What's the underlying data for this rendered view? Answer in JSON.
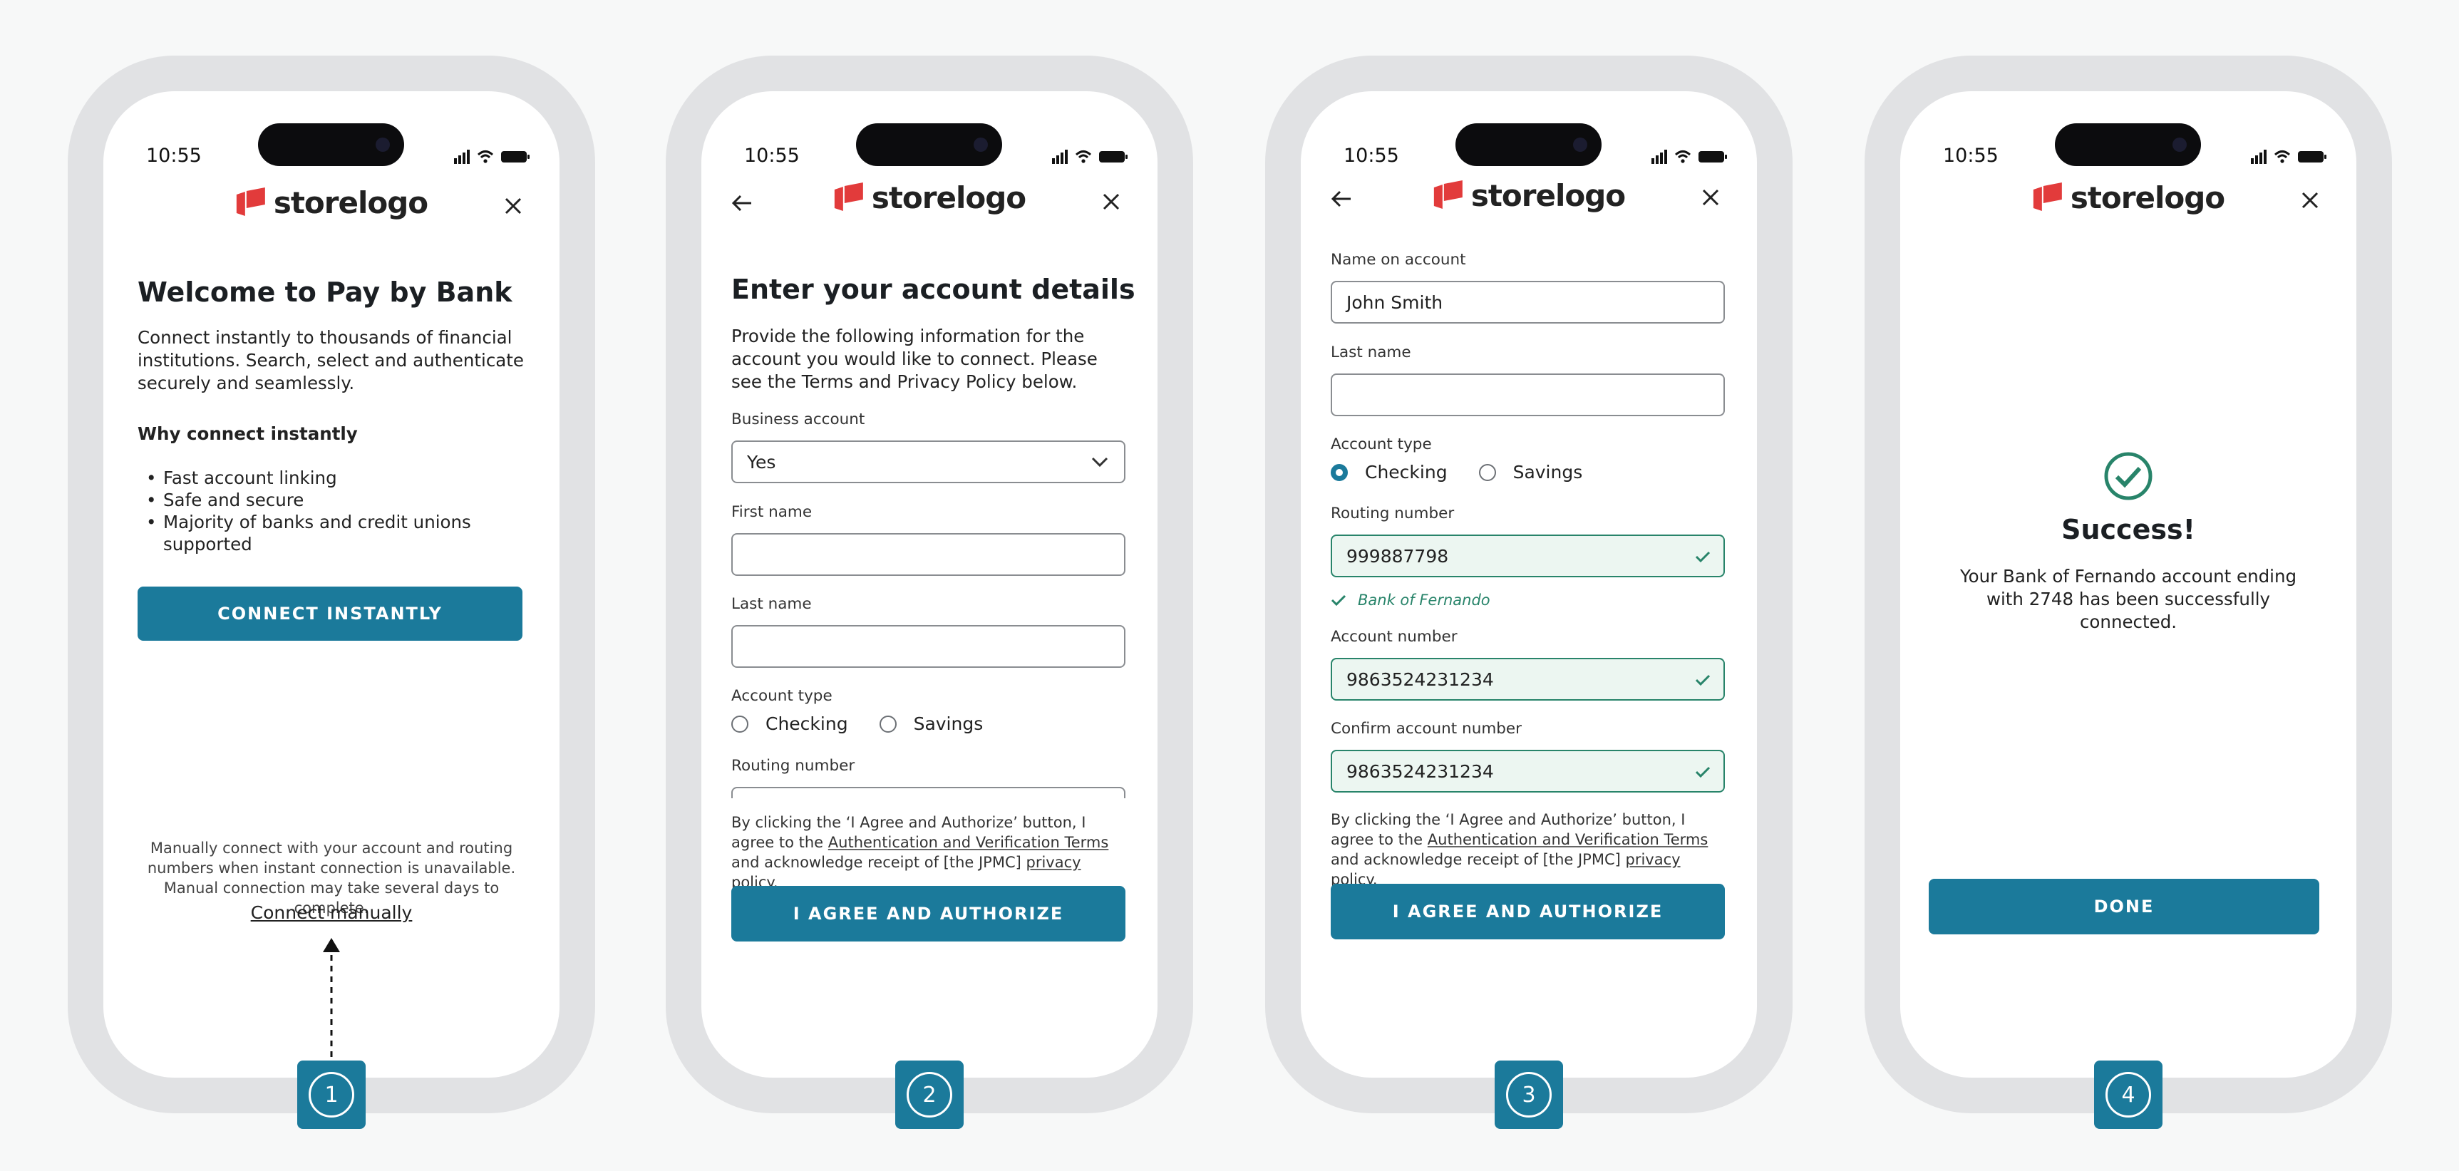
{
  "status": {
    "time": "10:55"
  },
  "brand": {
    "name": "storelogo",
    "color": "#e23b3b"
  },
  "accent": "#1b7a9b",
  "success_color": "#28846a",
  "screen1": {
    "title": "Welcome to Pay by Bank",
    "intro": "Connect instantly to thousands of financial institutions. Search, select and authenticate securely and seamlessly.",
    "why_heading": "Why connect instantly",
    "bullets": [
      "Fast account linking",
      "Safe and secure",
      "Majority of banks and credit unions supported"
    ],
    "cta": "CONNECT INSTANTLY",
    "manual_note": "Manually connect with your account and routing numbers when instant connection is unavailable. Manual connection may take several days to complete.",
    "manual_link": "Connect manually",
    "step": "1"
  },
  "screen2": {
    "title": "Enter your account details",
    "intro": "Provide the following information for the account you would like to connect. Please see the Terms and Privacy Policy below.",
    "business_label": "Business account",
    "business_value": "Yes",
    "first_name_label": "First name",
    "last_name_label": "Last name",
    "account_type_label": "Account type",
    "checking": "Checking",
    "savings": "Savings",
    "routing_label": "Routing number",
    "legal_1": "By clicking the ‘I Agree and Authorize’ button, I agree to the ",
    "legal_link": "Authentication and Verification Terms",
    "legal_2": " and acknowledge receipt of [the JPMC] ",
    "legal_link2": "privacy policy",
    "legal_3": ".",
    "cta": "I AGREE AND AUTHORIZE",
    "step": "2"
  },
  "screen3": {
    "name_label": "Name on account",
    "name_value": "John Smith",
    "last_name_label": "Last name",
    "account_type_label": "Account type",
    "checking": "Checking",
    "savings": "Savings",
    "routing_label": "Routing number",
    "routing_value": "999887798",
    "bank_confirm": "Bank of Fernando",
    "account_label": "Account number",
    "account_value": "9863524231234",
    "confirm_label": "Confirm account number",
    "confirm_value": "9863524231234",
    "legal_1": "By clicking the ‘I Agree and Authorize’ button, I agree to the ",
    "legal_link": "Authentication and Verification Terms",
    "legal_2": " and acknowledge receipt of [the JPMC] ",
    "legal_link2": "privacy policy",
    "legal_3": ".",
    "cta": "I AGREE AND AUTHORIZE",
    "step": "3"
  },
  "screen4": {
    "title": "Success!",
    "message": "Your Bank of Fernando account ending with 2748 has been successfully connected.",
    "cta": "DONE",
    "step": "4"
  }
}
